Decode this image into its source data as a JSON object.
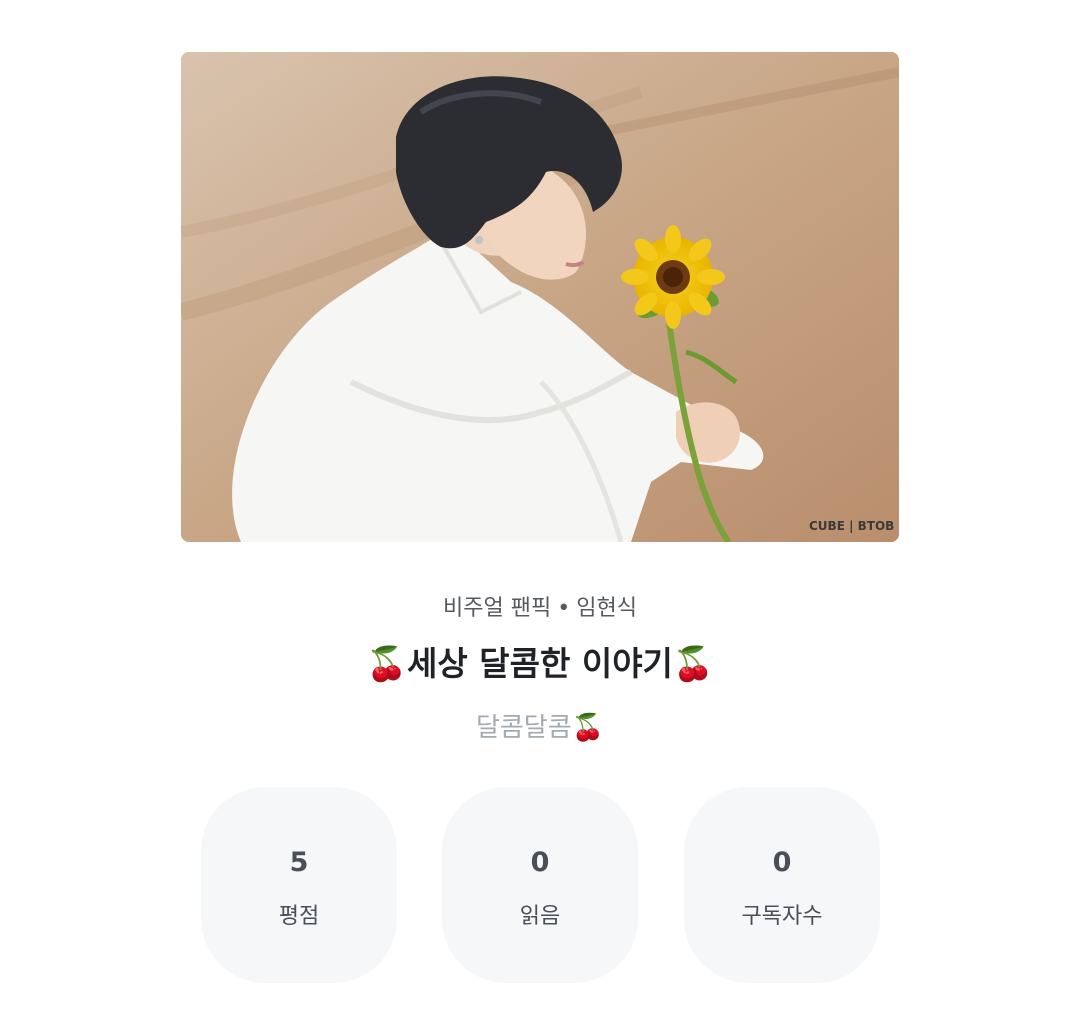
{
  "work": {
    "category": "비주얼 팬픽",
    "separator": "•",
    "author": "임현식",
    "title": "🍒세상 달콤한 이야기🍒",
    "subtitle": "달콤달콤🍒",
    "cover_watermark": "CUBE | BTOB"
  },
  "stats": [
    {
      "value": "5",
      "label": "평점"
    },
    {
      "value": "0",
      "label": "읽음"
    },
    {
      "value": "0",
      "label": "구독자수"
    }
  ],
  "colors": {
    "title": "#1f2226",
    "subtitle": "#a3a9b1",
    "stat_bg": "#f6f7f9"
  }
}
